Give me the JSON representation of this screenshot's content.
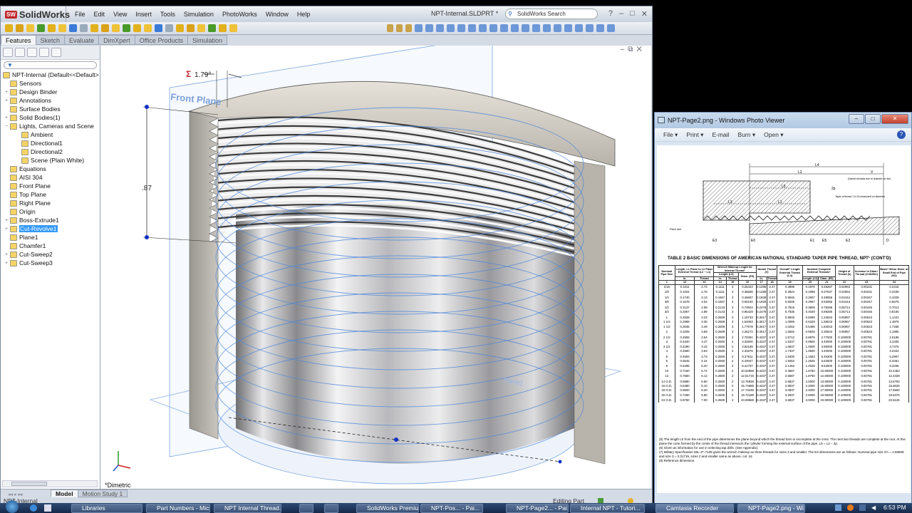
{
  "solidworks": {
    "brand": "SolidWorks",
    "brand_badge": "SW",
    "menu": [
      "File",
      "Edit",
      "View",
      "Insert",
      "Tools",
      "Simulation",
      "PhotoWorks",
      "Window",
      "Help"
    ],
    "document_title": "NPT-Internal.SLDPRT *",
    "search_placeholder": "SolidWorks Search",
    "window_buttons": [
      "?",
      "–",
      "□",
      "✕"
    ],
    "toolbar_icons": [
      "extruded-boss-icon",
      "revolved-boss-icon",
      "swept-boss-icon",
      "lofted-boss-icon",
      "boundary-boss-icon",
      "extruded-cut-icon",
      "hole-wizard-icon",
      "revolved-cut-icon",
      "swept-cut-icon",
      "lofted-cut-icon",
      "boundary-cut-icon",
      "fillet-icon",
      "linear-pattern-icon",
      "rib-icon",
      "draft-icon",
      "shell-icon",
      "wrap-icon",
      "dome-icon",
      "freeform-icon",
      "reference-geometry-icon",
      "curves-icon",
      "instant3d-icon"
    ],
    "view_icons": [
      "measure-icon",
      "sketch-line-icon",
      "normal-to-icon",
      "front-view-icon",
      "back-view-icon",
      "left-view-icon",
      "right-view-icon",
      "top-view-icon",
      "bottom-view-icon",
      "isometric-icon",
      "trimetric-icon",
      "dimetric-icon",
      "section-view-icon",
      "wireframe-icon",
      "hidden-lines-visible-icon",
      "hidden-lines-removed-icon",
      "shaded-edges-icon",
      "shaded-icon",
      "shadows-icon",
      "realview-icon",
      "appearance-icon",
      "spell-check-icon"
    ],
    "command_tabs": [
      "Features",
      "Sketch",
      "Evaluate",
      "DimXpert",
      "Office Products",
      "Simulation"
    ],
    "active_tab": "Features",
    "tree": {
      "root": "NPT-Internal  (Default<<Default>",
      "items": [
        {
          "label": "Sensors",
          "level": 1,
          "expand": ""
        },
        {
          "label": "Design Binder",
          "level": 1,
          "expand": "+"
        },
        {
          "label": "Annotations",
          "level": 1,
          "expand": "+"
        },
        {
          "label": "Surface Bodies",
          "level": 1,
          "expand": ""
        },
        {
          "label": "Solid Bodies(1)",
          "level": 1,
          "expand": "+"
        },
        {
          "label": "Lights, Cameras and Scene",
          "level": 1,
          "expand": "−"
        },
        {
          "label": "Ambient",
          "level": 2,
          "expand": ""
        },
        {
          "label": "Directional1",
          "level": 2,
          "expand": ""
        },
        {
          "label": "Directional2",
          "level": 2,
          "expand": ""
        },
        {
          "label": "Scene (Plain White)",
          "level": 2,
          "expand": ""
        },
        {
          "label": "Equations",
          "level": 1,
          "expand": ""
        },
        {
          "label": "AISI 304",
          "level": 1,
          "expand": ""
        },
        {
          "label": "Front Plane",
          "level": 1,
          "expand": ""
        },
        {
          "label": "Top Plane",
          "level": 1,
          "expand": ""
        },
        {
          "label": "Right Plane",
          "level": 1,
          "expand": ""
        },
        {
          "label": "Origin",
          "level": 1,
          "expand": ""
        },
        {
          "label": "Boss-Extrude1",
          "level": 1,
          "expand": "+"
        },
        {
          "label": "Cut-Revolve1",
          "level": 1,
          "expand": "+",
          "selected": true
        },
        {
          "label": "Plane1",
          "level": 1,
          "expand": ""
        },
        {
          "label": "Chamfer1",
          "level": 1,
          "expand": ""
        },
        {
          "label": "Cut-Sweep2",
          "level": 1,
          "expand": "+"
        },
        {
          "label": "Cut-Sweep3",
          "level": 1,
          "expand": "+"
        }
      ]
    },
    "viewport": {
      "plane_label": "Front Plane",
      "angle_dim": "1.79°",
      "angle_symbol": "Σ",
      "height_dim": ".87",
      "view_name": "*Dimetric",
      "plane1_label": "Plane1"
    },
    "bottom_tabs": [
      "Model",
      "Motion Study 1"
    ],
    "status": {
      "left": "NPT-Internal",
      "right": "Editing Part"
    }
  },
  "photo_viewer": {
    "title": "NPT-Page2.png - Windows Photo Viewer",
    "menu": [
      "File ▾",
      "Print ▾",
      "E-mail",
      "Burn ▾",
      "Open ▾"
    ],
    "diagram_labels": {
      "l4": "L4",
      "l2": "L2",
      "v": "V",
      "vanish": "(Vanish threads due to chamfer on die)",
      "l5": "L5",
      "p2": "2p",
      "taper": "Taper of thread 1 in 16 measured on diameter",
      "l3": "L3",
      "l1": "L1",
      "pitch": "Pitch line",
      "e3": "E3",
      "e0": "E0",
      "e1": "E1",
      "e5": "E5",
      "e2": "E2",
      "d": "D"
    },
    "table_title": "TABLE 2   BASIC DIMENSIONS OF AMERICAN NATIONAL STANDARD TAPER PIPE THREAD, NPT¹ (CONT'D)",
    "headers": {
      "nominal": "Nominal Pipe Size",
      "l1l2": "Length, L1 Plane to L2 Plane External Thread (L2 − L1)",
      "wrench": "Wrench Makeup Length for Internal Thread⁷",
      "wrench_len": "Length (L3)",
      "wrench_diam": "Diam. (E3)",
      "vanish": "Vanish Thread (V)",
      "overall": "Overall⁸ Length External Thread (L4)",
      "complete": "Nominal Complete External Threads⁵",
      "complete_len": "Length (L5)",
      "complete_diam": "Diam. (E5)",
      "height": "Height of Thread (h)",
      "increase": "Increase in Diam./ Thread (0.0625/n)",
      "minor": "Basic⁶ Minor Diam. at Small End of Pipe (K0)",
      "in": "in.",
      "thread": "Thread",
      "colnums": [
        "1",
        "12",
        "13",
        "14",
        "15",
        "16",
        "17",
        "18",
        "19",
        "20",
        "21",
        "22",
        "23",
        "24"
      ]
    },
    "rows": [
      [
        "1/16",
        "0.1011",
        "2.73",
        "0.1111",
        "3",
        "0.26424",
        "0.1285",
        "3.47",
        "0.3896",
        "0.1870",
        "0.28287",
        "0.02963",
        "0.00231",
        "0.2416"
      ],
      [
        "1/8",
        "0.1024",
        "2.76",
        "0.1111",
        "3",
        "0.35656",
        "0.1285",
        "3.47",
        "0.3924",
        "0.1898",
        "0.37537",
        "0.02963",
        "0.00231",
        "0.3339"
      ],
      [
        "1/4",
        "0.1740",
        "3.13",
        "0.1667",
        "3",
        "0.46697",
        "0.1928",
        "3.47",
        "0.5946",
        "0.2907",
        "0.49556",
        "0.04444",
        "0.00347",
        "0.4329"
      ],
      [
        "3/8",
        "0.1678",
        "3.02",
        "0.1667",
        "3",
        "0.60160",
        "0.1928",
        "3.47",
        "0.6006",
        "0.2967",
        "0.63056",
        "0.04444",
        "0.00347",
        "0.5676"
      ],
      [
        "1/2",
        "0.2137",
        "2.99",
        "0.2143",
        "3",
        "0.74504",
        "0.2478",
        "3.47",
        "0.7815",
        "0.3909",
        "0.78286",
        "0.05714",
        "0.00446",
        "0.7013"
      ],
      [
        "3/4",
        "0.2067",
        "2.89",
        "0.2143",
        "3",
        "0.95429",
        "0.2478",
        "3.47",
        "0.7935",
        "0.4029",
        "0.99286",
        "0.05714",
        "0.00446",
        "0.9105"
      ],
      [
        "1",
        "0.2828",
        "3.23",
        "0.2609",
        "3",
        "1.19733",
        "0.3017",
        "3.47",
        "0.9845",
        "0.5089",
        "1.24543",
        "0.06957",
        "0.00543",
        "1.1441"
      ],
      [
        "1 1/4",
        "0.2868",
        "3.30",
        "0.2609",
        "3",
        "1.54083",
        "0.3017",
        "3.47",
        "1.0085",
        "0.5329",
        "1.59043",
        "0.06957",
        "0.00543",
        "1.4876"
      ],
      [
        "1 1/2",
        "0.3035",
        "3.49",
        "0.2609",
        "3",
        "1.77978",
        "0.3017",
        "3.47",
        "1.0252",
        "0.5496",
        "1.83043",
        "0.06957",
        "0.00543",
        "1.7265"
      ],
      [
        "2",
        "0.3205",
        "3.69",
        "0.2609",
        "3",
        "2.25272",
        "0.3017",
        "3.47",
        "1.0582",
        "0.5826",
        "2.30543",
        "0.06957",
        "0.00543",
        "2.1995"
      ],
      [
        "2 1/2",
        "0.4555",
        "3.64",
        "0.2500",
        "2",
        "2.70391",
        "0.4337",
        "3.47",
        "1.5712",
        "0.8875",
        "2.77500",
        "0.100000",
        "0.00781",
        "2.6195"
      ],
      [
        "3",
        "0.4340",
        "3.47",
        "0.2500",
        "2",
        "3.32500",
        "0.4337",
        "3.47",
        "1.6337",
        "0.9500",
        "3.40000",
        "0.100000",
        "0.00781",
        "3.2406"
      ],
      [
        "3 1/2",
        "0.4290",
        "3.43",
        "0.2500",
        "2",
        "3.82188",
        "0.4337",
        "3.47",
        "1.6837",
        "1.0000",
        "3.90000",
        "0.100000",
        "0.00781",
        "3.7375"
      ],
      [
        "4",
        "0.4560",
        "3.63",
        "0.2500",
        "2",
        "4.31875",
        "0.4337",
        "3.47",
        "1.7337",
        "1.0500",
        "4.40000",
        "0.100000",
        "0.00781",
        "4.2344"
      ],
      [
        "5",
        "0.4693",
        "3.73",
        "0.2500",
        "2",
        "5.37511",
        "0.4337",
        "3.47",
        "1.8400",
        "1.1563",
        "5.46300",
        "0.100000",
        "0.00781",
        "5.2907"
      ],
      [
        "6",
        "0.5545",
        "4.44",
        "0.2500",
        "2",
        "6.43047",
        "0.4337",
        "3.47",
        "1.9462",
        "1.2625",
        "6.52500",
        "0.100000",
        "0.00781",
        "6.3461"
      ],
      [
        "8",
        "0.6495",
        "5.20",
        "0.2500",
        "2",
        "8.41797",
        "0.4337",
        "3.47",
        "2.1462",
        "1.4625",
        "8.52500",
        "0.100000",
        "0.00781",
        "8.3336"
      ],
      [
        "10",
        "0.7150",
        "5.72",
        "0.2500",
        "2",
        "10.52969",
        "0.4337",
        "3.47",
        "2.3587",
        "1.6750",
        "10.65000",
        "0.100000",
        "0.00781",
        "10.4453"
      ],
      [
        "12",
        "0.7650",
        "6.12",
        "0.2500",
        "2",
        "12.51719",
        "0.4337",
        "3.47",
        "2.5587",
        "1.8750",
        "12.65000",
        "0.100000",
        "0.00781",
        "12.4328"
      ],
      [
        "14 O.D.",
        "0.6880",
        "5.50",
        "0.2500",
        "2",
        "13.75938",
        "0.4337",
        "3.47",
        "2.6837",
        "2.0000",
        "13.90000",
        "0.100000",
        "0.00781",
        "13.6750"
      ],
      [
        "16 O.D.",
        "0.6380",
        "5.10",
        "0.2500",
        "2",
        "15.74688",
        "0.4337",
        "3.47",
        "2.8837",
        "2.2000",
        "15.90000",
        "0.100000",
        "0.00781",
        "15.6625"
      ],
      [
        "18 O.D.",
        "0.6500",
        "5.20",
        "0.2500",
        "2",
        "17.73438",
        "0.4337",
        "3.47",
        "3.0837",
        "2.4000",
        "17.90000",
        "0.100000",
        "0.00781",
        "17.6500"
      ],
      [
        "20 O.D.",
        "0.7250",
        "5.80",
        "0.2500",
        "2",
        "19.72188",
        "0.4337",
        "3.47",
        "3.2837",
        "2.6000",
        "19.90000",
        "0.100000",
        "0.00781",
        "19.6375"
      ],
      [
        "24 O.D.",
        "0.8750",
        "7.00",
        "0.2500",
        "2",
        "23.69688",
        "0.4337",
        "3.47",
        "3.6837",
        "3.0000",
        "23.90000",
        "0.100000",
        "0.00781",
        "23.6125"
      ]
    ],
    "notes": [
      "(5) The length L5 from the end of the pipe determines the plane beyond which the thread form is incomplete at the crest. The next two threads are complete at the root. At this plane the cone formed by the crests of the thread intersects the cylinder forming the external surface of the pipe. L5 = L2 − 2p.",
      "(6) Given as information for use in selecting tap drills. (See Appendix).",
      "(7) Military Specification MIL−P−7105 gives the wrench makeup as three threads for sizes 3 and smaller. The E3 dimensions are as follows: Nominal pipe size 2½ = 2.69609 and size 3 = 3.31719, sizes 2 and smaller same as above, col. 16.",
      "(8) Reference dimension."
    ]
  },
  "taskbar": {
    "items": [
      "Libraries",
      "Part Numbers - Micr...",
      "NPT Internal Thread...",
      "",
      "",
      "SolidWorks Premium",
      "NPT-Pos... - Pai...",
      "NPT-Page2... - Pai...",
      "Internal NPT - Tutori...",
      "Camtasia Recorder",
      "NPT-Page2.png - Wi..."
    ],
    "clock": "6:53 PM"
  },
  "colors": {
    "selection": "#3399ff",
    "plane_blue": "#4a86d8",
    "error_red": "#c0262b"
  }
}
